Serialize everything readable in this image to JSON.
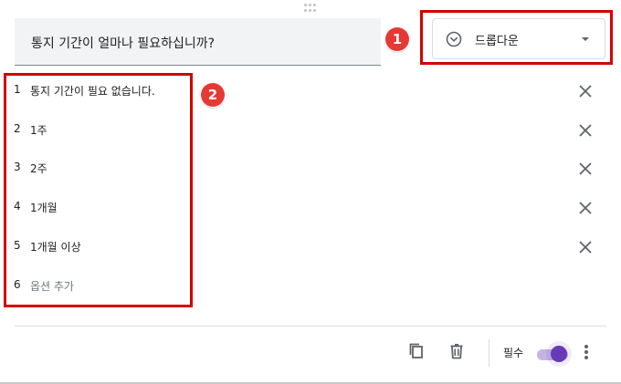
{
  "question": {
    "title": "통지 기간이 얼마나 필요하십니까?"
  },
  "question_type": {
    "label": "드롭다운",
    "icon": "dropdown-circle-icon"
  },
  "annotations": {
    "badge_1": "1",
    "badge_2": "2",
    "highlight_color": "#d40000",
    "badge_color": "#e53935"
  },
  "options": [
    {
      "number": "1",
      "label": "통지 기간이 필요 없습니다."
    },
    {
      "number": "2",
      "label": "1주"
    },
    {
      "number": "3",
      "label": "2주"
    },
    {
      "number": "4",
      "label": "1개월"
    },
    {
      "number": "5",
      "label": "1개월 이상"
    }
  ],
  "add_option": {
    "number": "6",
    "label": "옵션 추가"
  },
  "footer": {
    "required_label": "필수",
    "required_on": true,
    "accent_color": "#673ab7",
    "icons": [
      "copy-icon",
      "delete-icon",
      "more-vert-icon"
    ]
  }
}
